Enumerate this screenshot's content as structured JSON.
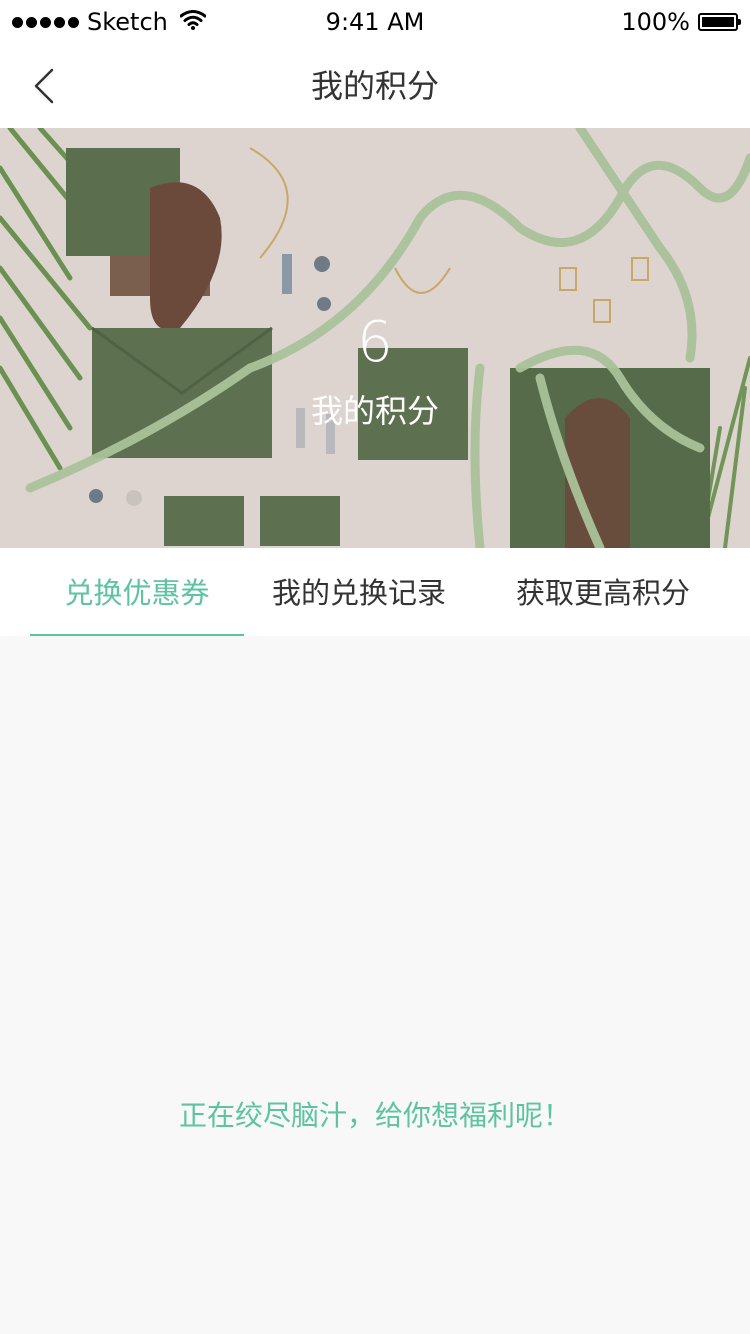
{
  "status_bar": {
    "carrier": "Sketch",
    "time": "9:41 AM",
    "battery": "100%"
  },
  "nav": {
    "title": "我的积分",
    "back_icon": "chevron-left-icon"
  },
  "hero": {
    "points_value": "6",
    "points_label": "我的积分"
  },
  "tabs": [
    {
      "label": "兑换优惠券",
      "active": true
    },
    {
      "label": "我的兑换记录",
      "active": false
    },
    {
      "label": "获取更高积分",
      "active": false
    }
  ],
  "content": {
    "empty_message": "正在绞尽脑汁，给你想福利呢！"
  },
  "colors": {
    "accent": "#5ec3a0",
    "text": "#333333",
    "background": "#f8f8f8"
  }
}
